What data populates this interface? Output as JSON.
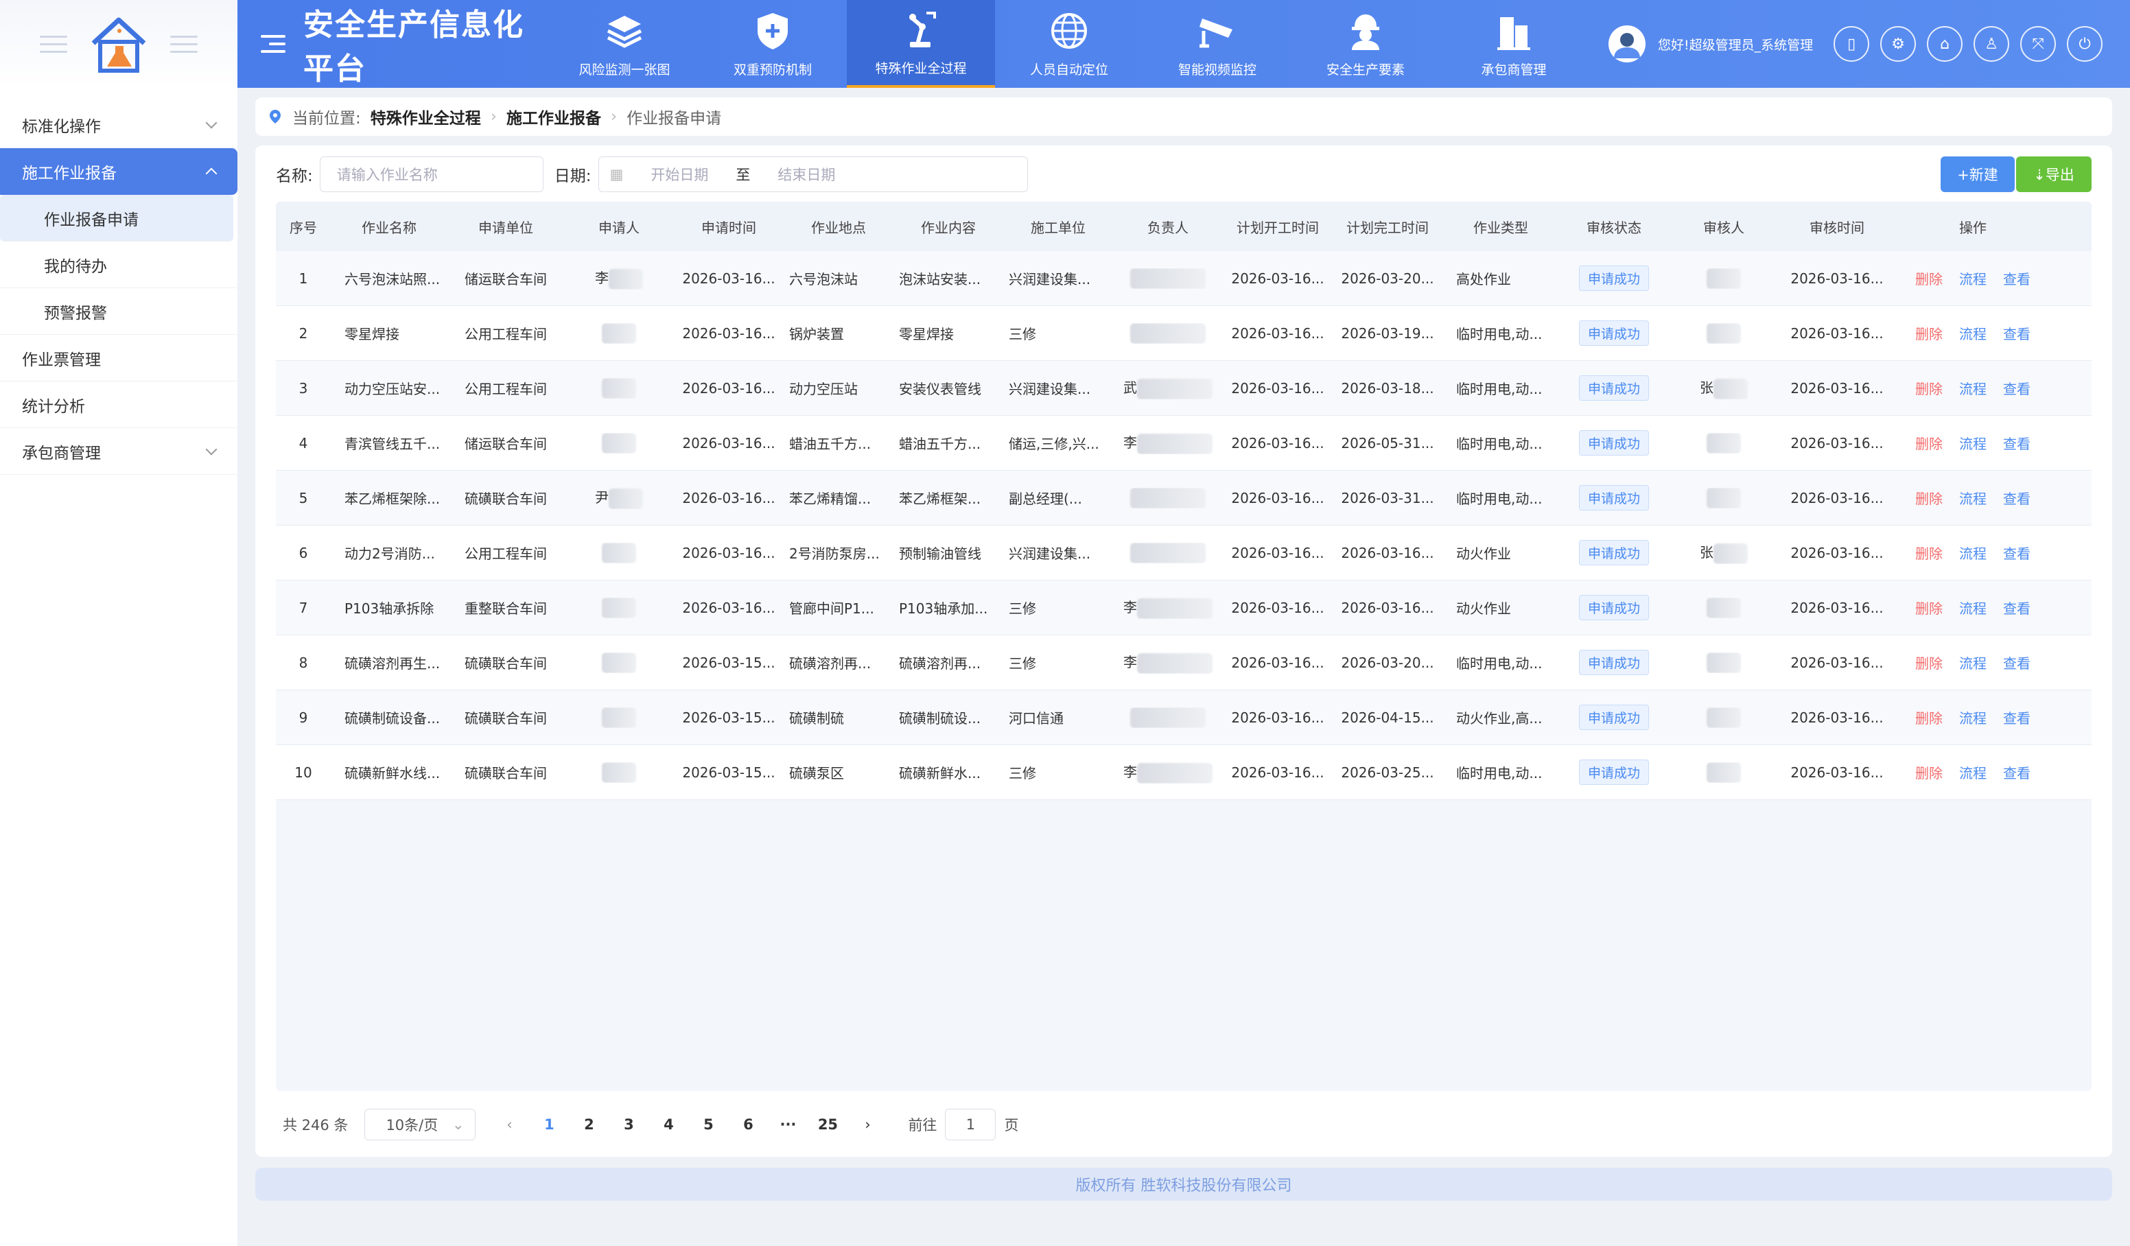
{
  "app": {
    "title": "安全生产信息化平台"
  },
  "nav": [
    {
      "label": "风险监测一张图",
      "icon": "layers-icon"
    },
    {
      "label": "双重预防机制",
      "icon": "shield-plus-icon"
    },
    {
      "label": "特殊作业全过程",
      "icon": "robot-arm-icon"
    },
    {
      "label": "人员自动定位",
      "icon": "globe-icon"
    },
    {
      "label": "智能视频监控",
      "icon": "camera-icon"
    },
    {
      "label": "安全生产要素",
      "icon": "worker-helmet-icon"
    },
    {
      "label": "承包商管理",
      "icon": "building-icon"
    }
  ],
  "user": {
    "greeting": "您好!超级管理员_系统管理"
  },
  "sidebar": {
    "items": [
      {
        "label": "标准化操作"
      },
      {
        "label": "施工作业报备"
      },
      {
        "label": "作业报备申请"
      },
      {
        "label": "我的待办"
      },
      {
        "label": "预警报警"
      },
      {
        "label": "作业票管理"
      },
      {
        "label": "统计分析"
      },
      {
        "label": "承包商管理"
      }
    ]
  },
  "breadcrumb": {
    "prefix": "当前位置:",
    "l1": "特殊作业全过程",
    "l2": "施工作业报备",
    "l3": "作业报备申请"
  },
  "filter": {
    "name_label": "名称:",
    "name_placeholder": "请输入作业名称",
    "date_label": "日期:",
    "start_placeholder": "开始日期",
    "to": "至",
    "end_placeholder": "结束日期"
  },
  "buttons": {
    "new": "+新建",
    "export": "⇣导出"
  },
  "table": {
    "headers": [
      "序号",
      "作业名称",
      "申请单位",
      "申请人",
      "申请时间",
      "作业地点",
      "作业内容",
      "施工单位",
      "负责人",
      "计划开工时间",
      "计划完工时间",
      "作业类型",
      "审核状态",
      "审核人",
      "审核时间",
      "操作"
    ],
    "actions": {
      "delete": "删除",
      "flow": "流程",
      "view": "查看"
    },
    "rows": [
      {
        "no": "1",
        "name": "六号泡沫站照...",
        "unit": "储运联合车间",
        "applicant": "李",
        "time": "2026-03-16...",
        "place": "六号泡沫站",
        "content": "泡沫站安装...",
        "builder": "兴润建设集...",
        "leader": "",
        "start": "2026-03-16...",
        "end": "2026-03-20...",
        "type": "高处作业",
        "status": "申请成功",
        "reviewer": "",
        "rtime": "2026-03-16..."
      },
      {
        "no": "2",
        "name": "零星焊接",
        "unit": "公用工程车间",
        "applicant": "",
        "time": "2026-03-16...",
        "place": "锅炉装置",
        "content": "零星焊接",
        "builder": "三修",
        "leader": "",
        "start": "2026-03-16...",
        "end": "2026-03-19...",
        "type": "临时用电,动...",
        "status": "申请成功",
        "reviewer": "",
        "rtime": "2026-03-16..."
      },
      {
        "no": "3",
        "name": "动力空压站安...",
        "unit": "公用工程车间",
        "applicant": "",
        "time": "2026-03-16...",
        "place": "动力空压站",
        "content": "安装仪表管线",
        "builder": "兴润建设集...",
        "leader": "武",
        "start": "2026-03-16...",
        "end": "2026-03-18...",
        "type": "临时用电,动...",
        "status": "申请成功",
        "reviewer": "张",
        "rtime": "2026-03-16..."
      },
      {
        "no": "4",
        "name": "青滨管线五千...",
        "unit": "储运联合车间",
        "applicant": "",
        "time": "2026-03-16...",
        "place": "蜡油五千方...",
        "content": "蜡油五千方...",
        "builder": "储运,三修,兴...",
        "leader": "李",
        "start": "2026-03-16...",
        "end": "2026-05-31...",
        "type": "临时用电,动...",
        "status": "申请成功",
        "reviewer": "",
        "rtime": "2026-03-16..."
      },
      {
        "no": "5",
        "name": "苯乙烯框架除...",
        "unit": "硫磺联合车间",
        "applicant": "尹",
        "time": "2026-03-16...",
        "place": "苯乙烯精馏...",
        "content": "苯乙烯框架...",
        "builder": "副总经理(...",
        "leader": "",
        "start": "2026-03-16...",
        "end": "2026-03-31...",
        "type": "临时用电,动...",
        "status": "申请成功",
        "reviewer": "",
        "rtime": "2026-03-16..."
      },
      {
        "no": "6",
        "name": "动力2号消防...",
        "unit": "公用工程车间",
        "applicant": "",
        "time": "2026-03-16...",
        "place": "2号消防泵房...",
        "content": "预制输油管线",
        "builder": "兴润建设集...",
        "leader": "",
        "start": "2026-03-16...",
        "end": "2026-03-16...",
        "type": "动火作业",
        "status": "申请成功",
        "reviewer": "张",
        "rtime": "2026-03-16..."
      },
      {
        "no": "7",
        "name": "P103轴承拆除",
        "unit": "重整联合车间",
        "applicant": "",
        "time": "2026-03-16...",
        "place": "管廊中间P1...",
        "content": "P103轴承加...",
        "builder": "三修",
        "leader": "李",
        "start": "2026-03-16...",
        "end": "2026-03-16...",
        "type": "动火作业",
        "status": "申请成功",
        "reviewer": "",
        "rtime": "2026-03-16..."
      },
      {
        "no": "8",
        "name": "硫磺溶剂再生...",
        "unit": "硫磺联合车间",
        "applicant": "",
        "time": "2026-03-15...",
        "place": "硫磺溶剂再...",
        "content": "硫磺溶剂再...",
        "builder": "三修",
        "leader": "李",
        "start": "2026-03-16...",
        "end": "2026-03-20...",
        "type": "临时用电,动...",
        "status": "申请成功",
        "reviewer": "",
        "rtime": "2026-03-16..."
      },
      {
        "no": "9",
        "name": "硫磺制硫设备...",
        "unit": "硫磺联合车间",
        "applicant": "",
        "time": "2026-03-15...",
        "place": "硫磺制硫",
        "content": "硫磺制硫设...",
        "builder": "河口信通",
        "leader": "",
        "start": "2026-03-16...",
        "end": "2026-04-15...",
        "type": "动火作业,高...",
        "status": "申请成功",
        "reviewer": "",
        "rtime": "2026-03-16..."
      },
      {
        "no": "10",
        "name": "硫磺新鲜水线...",
        "unit": "硫磺联合车间",
        "applicant": "",
        "time": "2026-03-15...",
        "place": "硫磺泵区",
        "content": "硫磺新鲜水...",
        "builder": "三修",
        "leader": "李",
        "start": "2026-03-16...",
        "end": "2026-03-25...",
        "type": "临时用电,动...",
        "status": "申请成功",
        "reviewer": "",
        "rtime": "2026-03-16..."
      }
    ]
  },
  "pagination": {
    "total": "共 246 条",
    "page_size": "10条/页",
    "pages": [
      "1",
      "2",
      "3",
      "4",
      "5",
      "6",
      "···",
      "25"
    ],
    "current": "1",
    "goto_prefix": "前往",
    "goto_value": "1",
    "goto_suffix": "页"
  },
  "footer": {
    "text": "版权所有 胜软科技股份有限公司"
  }
}
